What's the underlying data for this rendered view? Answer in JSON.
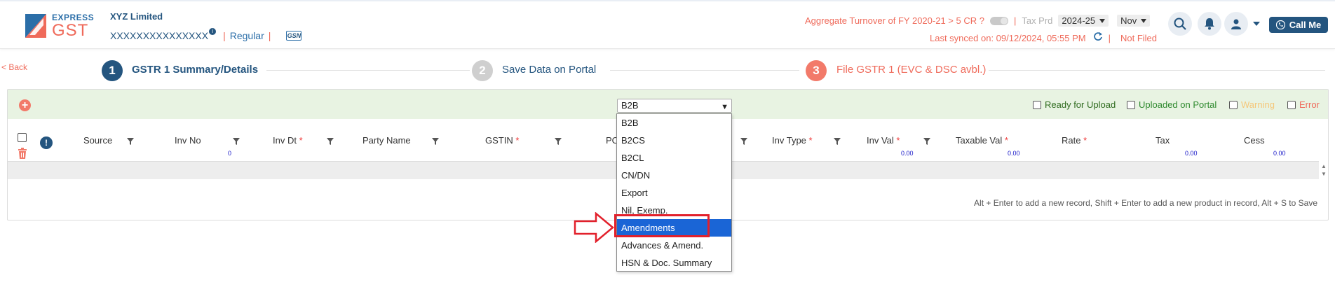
{
  "brand": {
    "express": "EXPRESS",
    "gst": "GST"
  },
  "company": {
    "name": "XYZ Limited",
    "gstin": "XXXXXXXXXXXXXXX",
    "gstin_info": "i",
    "type": "Regular",
    "pipe": "|",
    "gsn_badge": "GSN"
  },
  "header": {
    "turnover_text": "Aggregate Turnover of FY 2020-21 > 5 CR ?",
    "pipe": "|",
    "tax_prd_label": "Tax Prd",
    "year": "2024-25",
    "month": "Nov",
    "synced_text": "Last synced on: 09/12/2024, 05:55 PM",
    "status": "Not Filed",
    "call_me": "Call Me"
  },
  "steps": {
    "back": "< Back",
    "items": [
      {
        "num": "1",
        "label": "GSTR 1 Summary/Details"
      },
      {
        "num": "2",
        "label": "Save Data on Portal"
      },
      {
        "num": "3",
        "label": "File GSTR 1 (EVC & DSC avbl.)"
      }
    ]
  },
  "panel": {
    "section_value": "B2B",
    "legend": [
      {
        "label": "Ready for Upload",
        "color": "#2f6b1f"
      },
      {
        "label": "Uploaded on Portal",
        "color": "#2f8a2f"
      },
      {
        "label": "Warning",
        "color": "#f5c77a"
      },
      {
        "label": "Error",
        "color": "#ef6a5a"
      }
    ],
    "columns": [
      {
        "label": "Source",
        "required": ""
      },
      {
        "label": "Inv No",
        "required": ""
      },
      {
        "label": "Inv Dt",
        "required": "*"
      },
      {
        "label": "Party Name",
        "required": ""
      },
      {
        "label": "GSTIN",
        "required": "*"
      },
      {
        "label": "PO",
        "required": ""
      },
      {
        "label": "Inv Type",
        "required": "*"
      },
      {
        "label": "Inv Val",
        "required": "*"
      },
      {
        "label": "Taxable Val",
        "required": "*"
      },
      {
        "label": "Rate",
        "required": "*"
      },
      {
        "label": "Tax",
        "required": ""
      },
      {
        "label": "Cess",
        "required": ""
      }
    ],
    "sums": {
      "inv_no_count": "0",
      "inv_val": "0.00",
      "taxable_val": "0.00",
      "tax": "0.00",
      "cess": "0.00"
    },
    "hint": "Alt + Enter to add a new record, Shift + Enter to add a new product in record, Alt + S to Save"
  },
  "dropdown": {
    "options": [
      "B2B",
      "B2CS",
      "B2CL",
      "CN/DN",
      "Export",
      "Nil, Exemp.",
      "Amendments",
      "Advances & Amend.",
      "HSN & Doc. Summary"
    ],
    "highlighted": "Amendments"
  },
  "colors": {
    "accent": "#24557f",
    "brand_red": "#ef6a5a",
    "selected": "#1a65d6",
    "callout": "#e2202b"
  }
}
